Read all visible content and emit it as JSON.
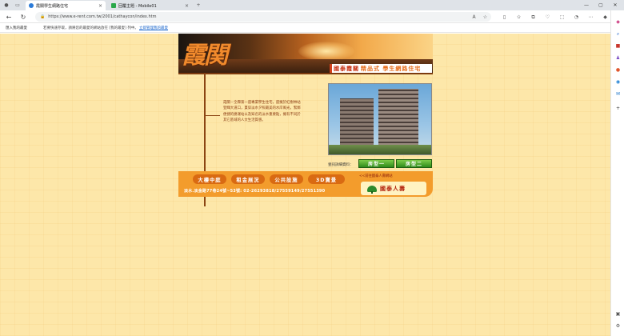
{
  "browser": {
    "tabs": [
      {
        "label": "霞關學生網路住宅",
        "active": true,
        "favicon_color": "#2b7bd8"
      },
      {
        "label": "回覆主題 - Mobile01",
        "active": false,
        "favicon_color": "#2aa84a"
      }
    ],
    "url": "https://www.e-rent.com.tw/2001/cathaycon/index.htm",
    "favorites_bar": {
      "import_label": "匯入我的最愛",
      "message": "若要快速存取，請將您的最愛的網站放在 [我的最愛] 列中。",
      "link_label": "立即管理我的最愛"
    }
  },
  "page": {
    "logo_text": "霞関",
    "tagline_red": "國泰霞關",
    "tagline_orange": "精品式 學生網路住宅",
    "intro_text": "霞關－全霖第一座專業學生住宅，座擁於紅樹林站 登輝大道口，貫穿淡水夕照最美的水岸風光。緊鄰便捷的捷運站以及知名的淡水重要點，擁有不同於其它區域的人文生活質感。",
    "detail_label": "壹訊詳細資料：",
    "type_buttons": [
      "房型一",
      "房型二"
    ],
    "menu": [
      "大樓中庭",
      "租金展況",
      "公共設施",
      "3D寶景"
    ],
    "contact": "淡水.淡金路77巷24號~53號: 02-26293818/27559149/27551390",
    "cathay_link": "<<前往國泰人壽網站",
    "cathay_name": "國泰人壽"
  }
}
